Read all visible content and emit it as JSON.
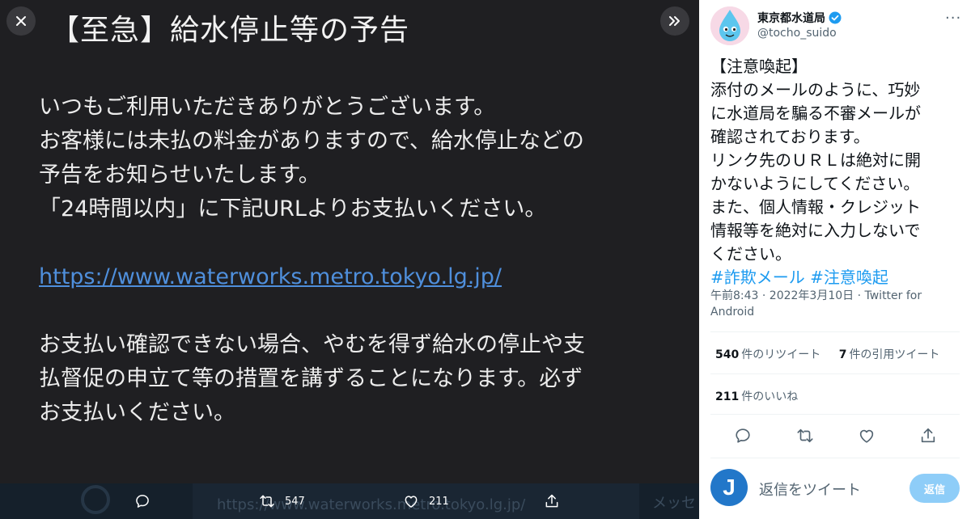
{
  "viewer": {
    "title": "【至急】給水停止等の予告",
    "body_lines": [
      "いつもご利用いただきありがとうございます。",
      "お客様には未払の料金がありますので、給水停止などの",
      "予告をお知らせいたします。",
      "「24時間以内」に下記URLよりお支払いください。"
    ],
    "url": "https://www.waterworks.metro.tokyo.lg.jp/",
    "body_lines_2": [
      "お支払い確認できない場合、やむを得ず給水の停止や支",
      "払督促の申立て等の措置を講ずることになります。必ず",
      "お支払いください。"
    ],
    "bottom_bar": {
      "retweet_count": "547",
      "like_count": "211",
      "ghost_text": "https://www.waterworks.metro.tokyo.lg.jp/",
      "ghost_right": "メッセ"
    },
    "icons": {
      "close": "close-icon",
      "next": "chevron-double-right-icon",
      "reply": "reply-icon",
      "retweet": "retweet-icon",
      "like": "heart-icon",
      "share": "share-icon"
    }
  },
  "tweet": {
    "display_name": "東京都水道局",
    "handle": "@tocho_suido",
    "lines": [
      "【注意喚起】",
      "添付のメールのように、巧妙",
      "に水道局を騙る不審メールが",
      "確認されております。",
      "リンク先のＵＲＬは絶対に開",
      "かないようにしてください。",
      "また、個人情報・クレジット",
      "情報等を絶対に入力しないで",
      "ください。"
    ],
    "hashtags": [
      "#詐欺メール",
      "#注意喚起"
    ],
    "meta_line_1": "午前8:43 · 2022年3月10日 · Twitter for",
    "meta_line_2": "Android",
    "retweets": {
      "count": "540",
      "label": "件のリツイート"
    },
    "quotes": {
      "count": "7",
      "label": "件の引用ツイート"
    },
    "likes": {
      "count": "211",
      "label": "件のいいね"
    },
    "reply_placeholder": "返信をツイート",
    "reply_button": "返信",
    "reply_avatar_letter": "J"
  },
  "colors": {
    "viewer_bg": "#1f1f22",
    "link": "#4f8fdc",
    "hashtag": "#1d9bf0",
    "reply_button": "#8ecdf8",
    "verified": "#1d9bf0"
  }
}
